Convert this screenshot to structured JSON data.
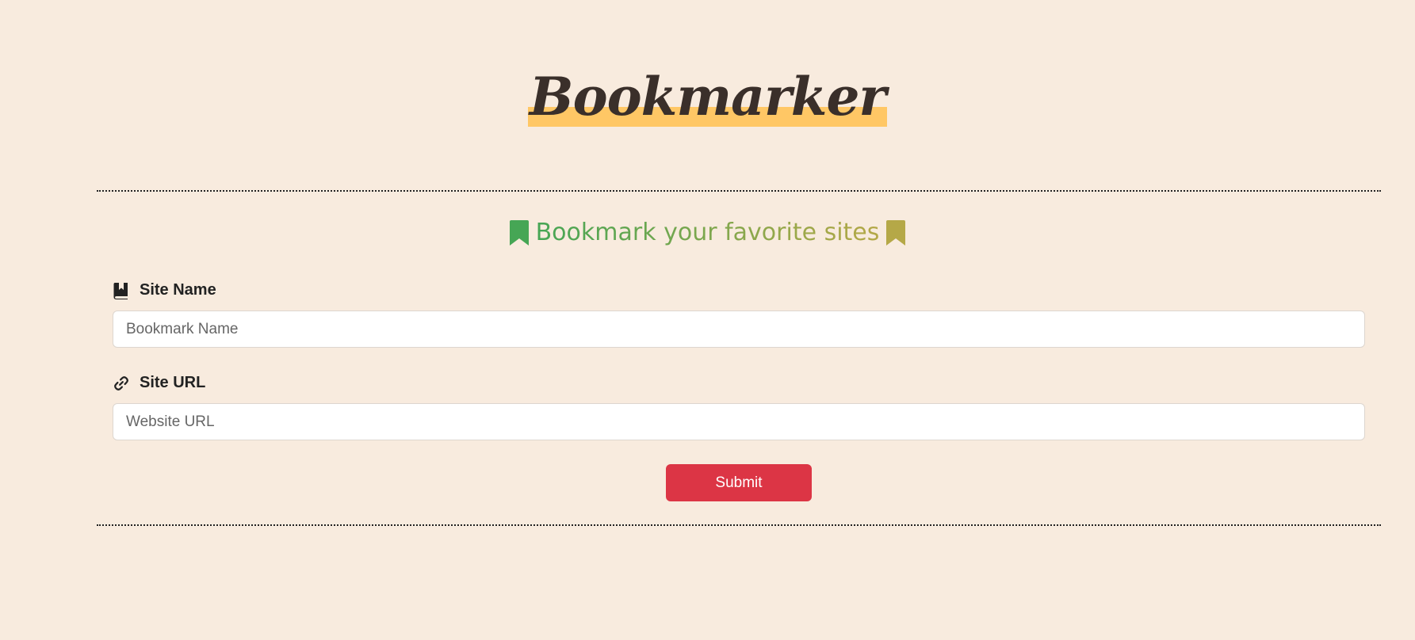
{
  "header": {
    "title": "Bookmarker"
  },
  "tagline": {
    "text": "Bookmark your favorite sites",
    "icon_left": "bookmark-icon",
    "icon_right": "bookmark-icon",
    "gradient_start": "#46a655",
    "gradient_end": "#b5a847"
  },
  "form": {
    "site_name": {
      "icon": "book-bookmark-icon",
      "label": "Site Name",
      "placeholder": "Bookmark Name",
      "value": ""
    },
    "site_url": {
      "icon": "link-icon",
      "label": "Site URL",
      "placeholder": "Website URL",
      "value": ""
    },
    "submit_label": "Submit"
  },
  "colors": {
    "background": "#f8ebde",
    "title_highlight": "#ffc765",
    "submit": "#dc3545"
  }
}
